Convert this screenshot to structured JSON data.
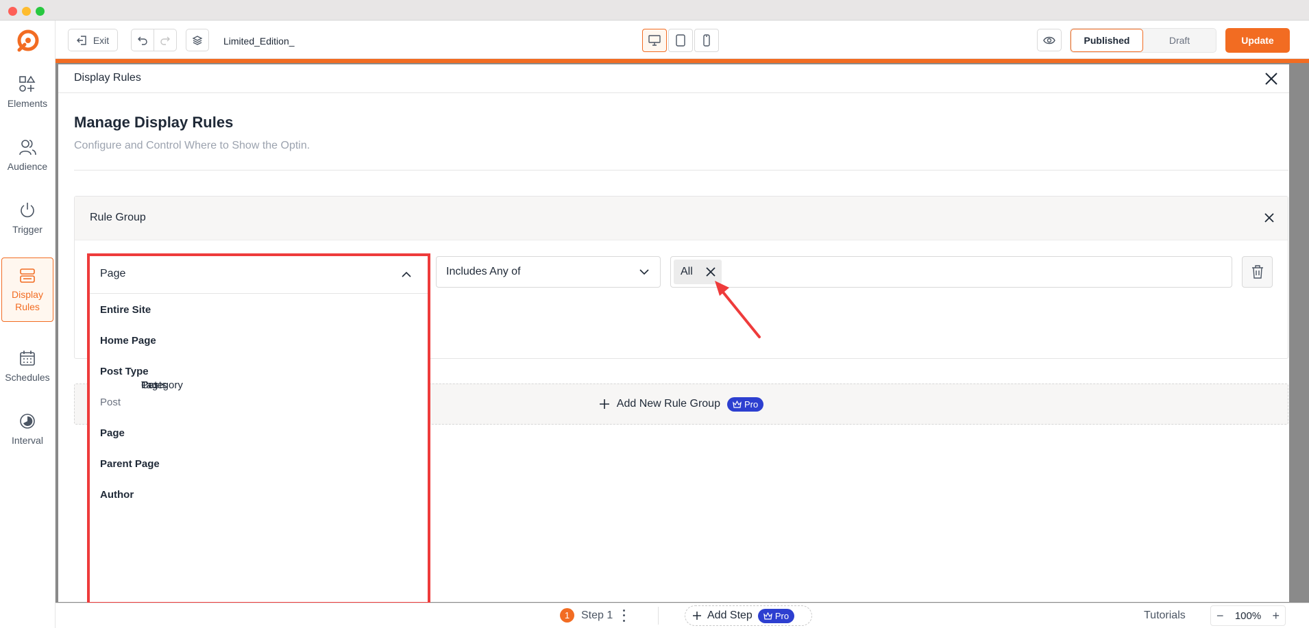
{
  "sidebar": {
    "items": [
      {
        "label": "Elements",
        "icon": "elements-icon"
      },
      {
        "label": "Audience",
        "icon": "audience-icon"
      },
      {
        "label": "Trigger",
        "icon": "power-icon"
      },
      {
        "label": "Display Rules",
        "icon": "display-rules-icon",
        "active": true
      },
      {
        "label": "Schedules",
        "icon": "calendar-icon"
      },
      {
        "label": "Interval",
        "icon": "interval-icon"
      }
    ]
  },
  "toolbar": {
    "exit_label": "Exit",
    "doc_title": "Limited_Edition_",
    "status_published": "Published",
    "status_draft": "Draft",
    "update_label": "Update"
  },
  "modal": {
    "header_title": "Display Rules",
    "title": "Manage Display Rules",
    "subtitle": "Configure and Control Where to Show the Optin.",
    "rule_group": {
      "title": "Rule Group",
      "condition": "Includes Any of",
      "tag": "All"
    },
    "add_group_label": "Add New Rule Group",
    "pro_label": "Pro"
  },
  "dropdown": {
    "selected": "Page",
    "items": [
      {
        "label": "Entire Site",
        "kind": "item"
      },
      {
        "label": "Home Page",
        "kind": "item"
      },
      {
        "label": "Post Type",
        "kind": "item"
      },
      {
        "label": "Post",
        "kind": "group"
      },
      {
        "label": "Posts",
        "kind": "sub"
      },
      {
        "label": "Category",
        "kind": "sub"
      },
      {
        "label": "Tag",
        "kind": "sub"
      },
      {
        "label": "Page",
        "kind": "item"
      },
      {
        "label": "Parent Page",
        "kind": "item"
      },
      {
        "label": "Author",
        "kind": "item"
      }
    ]
  },
  "bottom": {
    "step_number": "1",
    "step_label": "Step 1",
    "add_step_label": "Add Step",
    "pro_label": "Pro",
    "tutorials_label": "Tutorials",
    "zoom": "100%"
  },
  "colors": {
    "accent": "#f26c22",
    "pro": "#2d3fd0",
    "highlight": "#ee3b3b"
  }
}
